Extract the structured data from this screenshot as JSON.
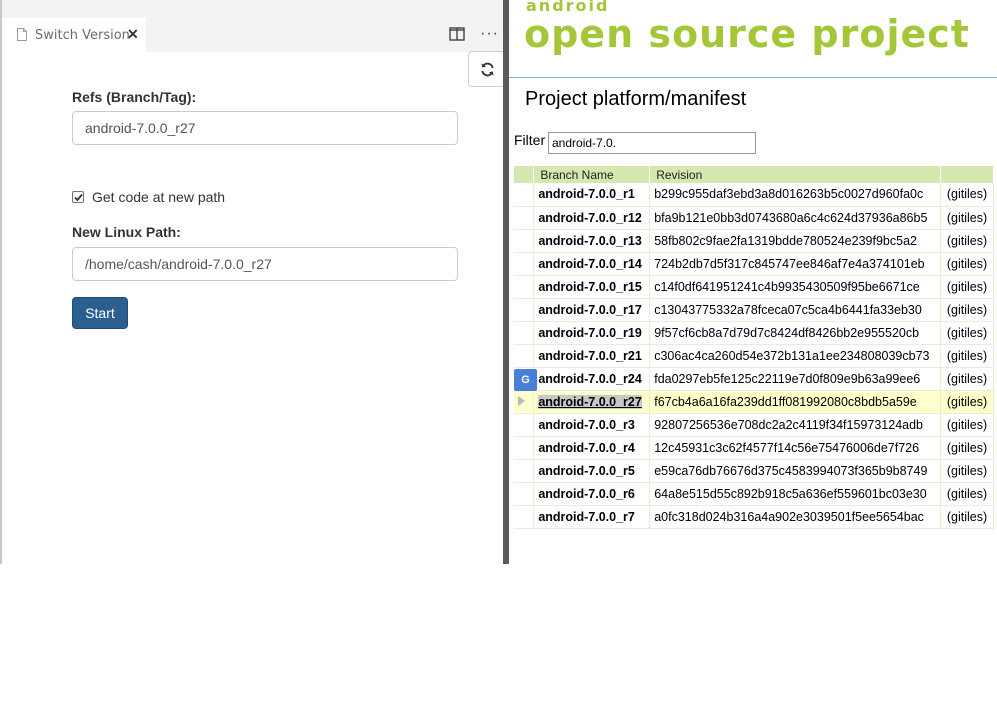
{
  "editor": {
    "tab": {
      "title": "Switch Version",
      "close_glyph": "✕",
      "icon": "file-icon"
    },
    "actions": {
      "split_icon": "split-editor-icon",
      "more_glyph": "···",
      "refresh_icon": "refresh-icon"
    },
    "form": {
      "refs_label": "Refs (Branch/Tag):",
      "refs_value": "android-7.0.0_r27",
      "checkbox_label": "Get code at new path",
      "checkbox_checked": true,
      "path_label": "New Linux Path:",
      "path_value": "/home/cash/android-7.0.0_r27",
      "start_label": "Start"
    }
  },
  "browser": {
    "logo_small": "android",
    "logo_big": "open source project",
    "project_title": "Project platform/manifest",
    "filter_label": "Filter",
    "filter_value": "android-7.0.",
    "table": {
      "headers": {
        "branch": "Branch Name",
        "revision": "Revision"
      },
      "rows": [
        {
          "branch": "android-7.0.0_r1",
          "revision": "b299c955daf3ebd3a8d016263b5c0027d960fa0c",
          "link": "(gitiles)"
        },
        {
          "branch": "android-7.0.0_r12",
          "revision": "bfa9b121e0bb3d0743680a6c4c624d37936a86b5",
          "link": "(gitiles)"
        },
        {
          "branch": "android-7.0.0_r13",
          "revision": "58fb802c9fae2fa1319bdde780524e239f9bc5a2",
          "link": "(gitiles)"
        },
        {
          "branch": "android-7.0.0_r14",
          "revision": "724b2db7d5f317c845747ee846af7e4a374101eb",
          "link": "(gitiles)"
        },
        {
          "branch": "android-7.0.0_r15",
          "revision": "c14f0df641951241c4b9935430509f95be6671ce",
          "link": "(gitiles)"
        },
        {
          "branch": "android-7.0.0_r17",
          "revision": "c13043775332a78fceca07c5ca4b6441fa33eb30",
          "link": "(gitiles)"
        },
        {
          "branch": "android-7.0.0_r19",
          "revision": "9f57cf6cb8a7d79d7c8424df8426bb2e955520cb",
          "link": "(gitiles)"
        },
        {
          "branch": "android-7.0.0_r21",
          "revision": "c306ac4ca260d54e372b131a1ee234808039cb73",
          "link": "(gitiles)"
        },
        {
          "branch": "android-7.0.0_r24",
          "revision": "fda0297eb5fe125c22119e7d0f809e9b63a99ee6",
          "link": "(gitiles)"
        },
        {
          "branch": "android-7.0.0_r27",
          "revision": "f67cb4a6a16fa239dd1ff081992080c8bdb5a59e",
          "link": "(gitiles)",
          "selected": true
        },
        {
          "branch": "android-7.0.0_r3",
          "revision": "92807256536e708dc2a2c4119f34f15973124adb",
          "link": "(gitiles)"
        },
        {
          "branch": "android-7.0.0_r4",
          "revision": "12c45931c3c62f4577f14c56e75476006de7f726",
          "link": "(gitiles)"
        },
        {
          "branch": "android-7.0.0_r5",
          "revision": "e59ca76db76676d375c4583994073f365b9b8749",
          "link": "(gitiles)"
        },
        {
          "branch": "android-7.0.0_r6",
          "revision": "64a8e515d55c892b918c5a636ef559601bc03e30",
          "link": "(gitiles)"
        },
        {
          "branch": "android-7.0.0_r7",
          "revision": "a0fc318d024b316a4a902e3039501f5ee5654bac",
          "link": "(gitiles)"
        }
      ]
    },
    "translate_icon": "google-translate-icon",
    "translate_glyph": "G"
  },
  "colors": {
    "accent_green": "#a4c639",
    "button_blue": "#2a5f8f",
    "table_header": "#d6e8b0",
    "selected_row": "#ffffcc"
  }
}
